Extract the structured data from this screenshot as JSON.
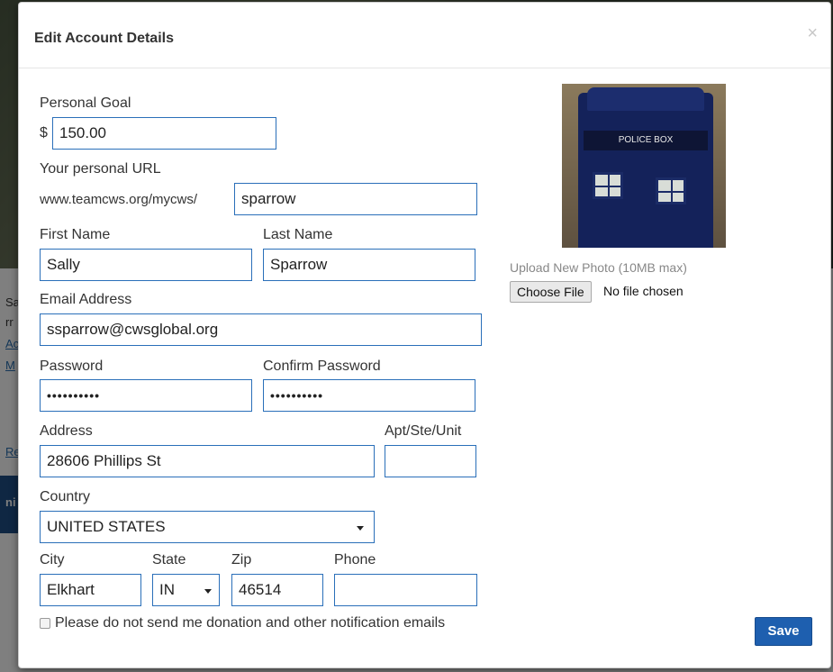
{
  "background": {
    "fragments": [
      "Sa",
      "rr",
      "Ac",
      "M",
      "Re",
      "ni"
    ]
  },
  "modal": {
    "title": "Edit Account Details",
    "close_glyph": "×"
  },
  "form": {
    "personal_goal": {
      "label": "Personal Goal",
      "currency": "$",
      "value": "150.00"
    },
    "personal_url": {
      "label": "Your personal URL",
      "prefix": "www.teamcws.org/mycws/",
      "value": "sparrow"
    },
    "first_name": {
      "label": "First Name",
      "value": "Sally"
    },
    "last_name": {
      "label": "Last Name",
      "value": "Sparrow"
    },
    "email": {
      "label": "Email Address",
      "value": "ssparrow@cwsglobal.org"
    },
    "password": {
      "label": "Password",
      "value": "••••••••••"
    },
    "confirm_password": {
      "label": "Confirm Password",
      "value": "••••••••••"
    },
    "address": {
      "label": "Address",
      "value": "28606 Phillips St"
    },
    "apt": {
      "label": "Apt/Ste/Unit",
      "value": ""
    },
    "country": {
      "label": "Country",
      "value": "UNITED STATES"
    },
    "city": {
      "label": "City",
      "value": "Elkhart"
    },
    "state": {
      "label": "State",
      "value": "IN"
    },
    "zip": {
      "label": "Zip",
      "value": "46514"
    },
    "phone": {
      "label": "Phone",
      "value": ""
    },
    "opt_out": {
      "label": "Please do not send me donation and other notification emails",
      "checked": false
    }
  },
  "photo": {
    "sign_text": "POLICE BOX",
    "upload_label": "Upload New Photo (10MB max)",
    "choose_button": "Choose File",
    "file_status": "No file chosen"
  },
  "actions": {
    "save": "Save"
  },
  "colors": {
    "input_border": "#2a6fb9",
    "save_button": "#1e5faf"
  }
}
